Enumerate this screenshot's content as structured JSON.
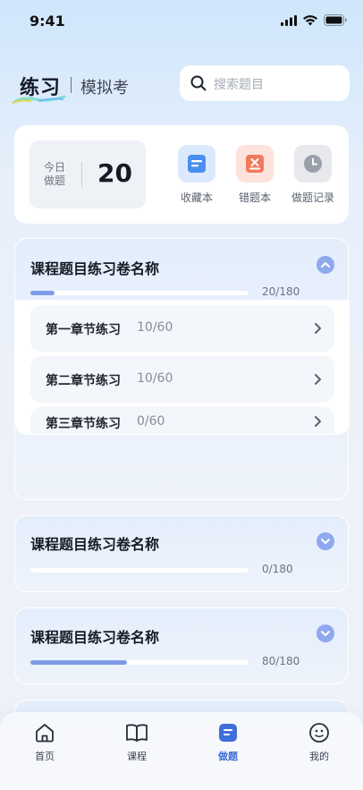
{
  "status_bar": {
    "time": "9:41"
  },
  "header": {
    "title": "练习",
    "subtitle": "模拟考"
  },
  "search": {
    "placeholder": "搜索题目"
  },
  "stats": {
    "today_label": "今日做题",
    "today_count": "20",
    "shortcuts": [
      {
        "label": "收藏本",
        "icon": "bookmark-icon",
        "color": "#4a8ef0"
      },
      {
        "label": "错题本",
        "icon": "wrong-answer-icon",
        "color": "#f07a5c"
      },
      {
        "label": "做题记录",
        "icon": "clock-icon",
        "color": "#9aa0aa"
      }
    ]
  },
  "papers": [
    {
      "title": "课程题目练习卷名称",
      "progress_text": "20/180",
      "progress": 0.111,
      "expanded": true,
      "chapters": [
        {
          "name": "第一章节练习",
          "progress": "10/60"
        },
        {
          "name": "第二章节练习",
          "progress": "10/60"
        },
        {
          "name": "第三章节练习",
          "progress": "0/60"
        }
      ]
    },
    {
      "title": "课程题目练习卷名称",
      "progress_text": "0/180",
      "progress": 0,
      "expanded": false
    },
    {
      "title": "课程题目练习卷名称",
      "progress_text": "80/180",
      "progress": 0.444,
      "expanded": false
    }
  ],
  "tabs": [
    {
      "label": "首页",
      "icon": "home-icon",
      "active": false
    },
    {
      "label": "课程",
      "icon": "book-icon",
      "active": false
    },
    {
      "label": "做题",
      "icon": "practice-icon",
      "active": true
    },
    {
      "label": "我的",
      "icon": "profile-icon",
      "active": false
    }
  ],
  "colors": {
    "accent": "#3f6fd8",
    "progress": "#7f9ce8",
    "toggle": "#8fa8ee"
  }
}
